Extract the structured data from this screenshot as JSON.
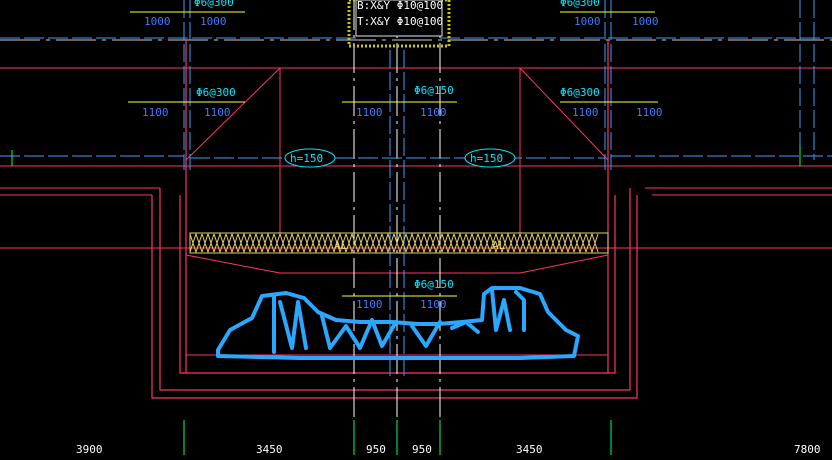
{
  "colors": {
    "background": "#000000",
    "wall": "#ff3366",
    "grid_dash": "#ffffff",
    "cyan_line": "#3aa0ff",
    "green": "#00ff66",
    "yellow": "#ffff33",
    "text_blue": "#3e7bff",
    "text_cyan": "#00e6ff",
    "hatch": "#e6d066",
    "markup": "#2aa7ff"
  },
  "top_box": {
    "line1": "B:X&Y Φ10@100",
    "line2": "T:X&Y Φ10@100"
  },
  "rebar_labels": {
    "top_left": "Φ6@300",
    "top_right": "Φ6@300",
    "mid_left": "Φ6@300",
    "mid_center": "Φ6@150",
    "mid_right": "Φ6@300",
    "lower_center": "Φ6@150"
  },
  "span_labels": {
    "top_left_a": "1000",
    "top_left_b": "1000",
    "top_right_a": "1000",
    "top_right_b": "1000",
    "mid_left_a": "1100",
    "mid_left_b": "1100",
    "mid_center_a": "1100",
    "mid_center_b": "1100",
    "mid_right_a": "1100",
    "mid_right_b": "1100",
    "low_center_a": "1100",
    "low_center_b": "1100"
  },
  "thickness_tags": {
    "left": "h=150",
    "right": "h=150"
  },
  "beam_tags": {
    "left": "AL",
    "right": "AL"
  },
  "dimensions": [
    "3900",
    "3450",
    "950",
    "950",
    "3450",
    "7800"
  ]
}
